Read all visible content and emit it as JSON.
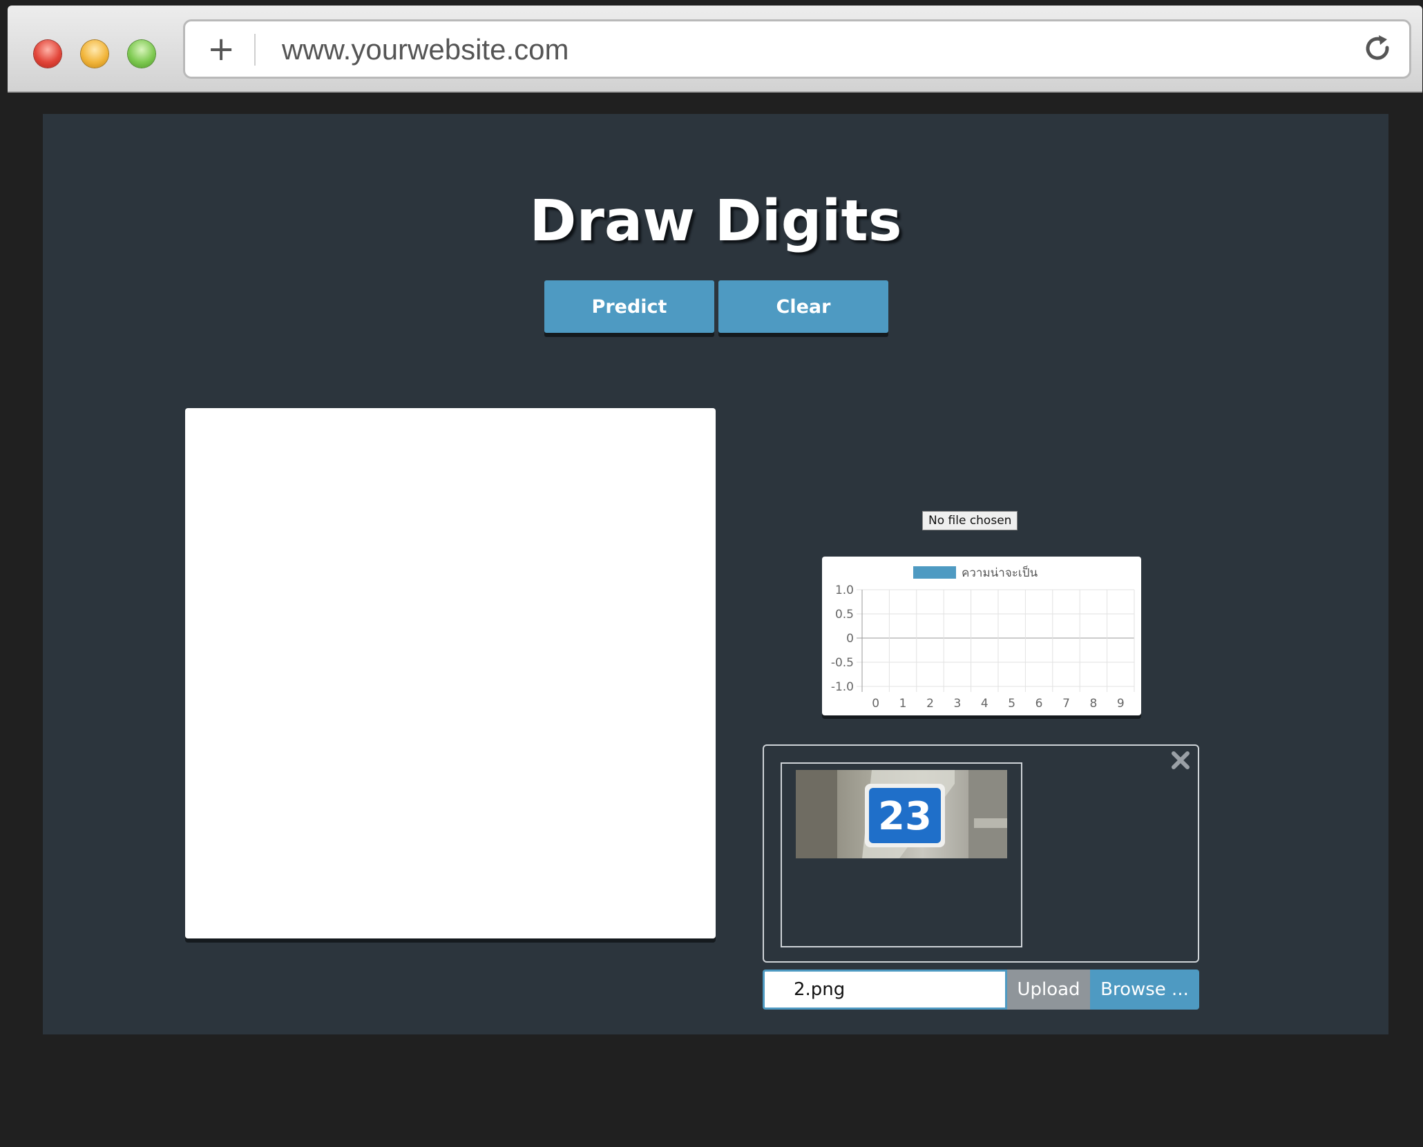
{
  "browser": {
    "url": "www.yourwebsite.com"
  },
  "page": {
    "title": "Draw Digits",
    "predict_label": "Predict",
    "clear_label": "Clear",
    "file_status": "No file chosen"
  },
  "chart_data": {
    "type": "bar",
    "categories": [
      "0",
      "1",
      "2",
      "3",
      "4",
      "5",
      "6",
      "7",
      "8",
      "9"
    ],
    "series": [
      {
        "name": "ความน่าจะเป็น",
        "values": [
          0,
          0,
          0,
          0,
          0,
          0,
          0,
          0,
          0,
          0
        ],
        "color": "#4e9ac2"
      }
    ],
    "yticks": [
      "1.0",
      "0.5",
      "0",
      "-0.5",
      "-1.0"
    ],
    "ylim": [
      -1.0,
      1.0
    ],
    "grid": true,
    "legend": "top"
  },
  "preview": {
    "image_text": "23"
  },
  "file_input": {
    "file_name": "2.png",
    "upload_label": "Upload",
    "browse_label": "Browse ..."
  },
  "colors": {
    "accent": "#4e9ac2",
    "page_bg": "#2c353d",
    "outer_bg": "#202020"
  },
  "icons": {
    "new_tab": "plus-icon",
    "reload": "reload-icon",
    "close": "close-icon"
  }
}
